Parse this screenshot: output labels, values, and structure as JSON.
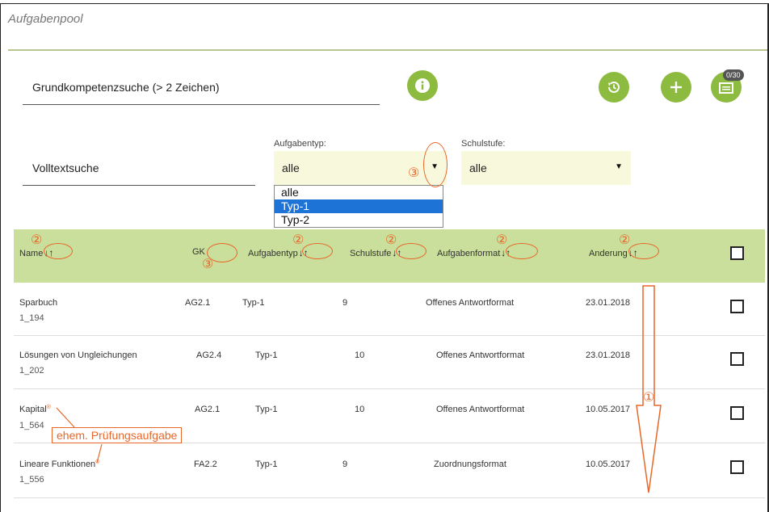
{
  "app": {
    "title": "Aufgabenpool"
  },
  "search": {
    "competence_placeholder": "Grundkompetenzsuche (> 2 Zeichen)",
    "fulltext_placeholder": "Volltextsuche"
  },
  "toolbar": {
    "info_icon": "info-icon",
    "history_icon": "history-icon",
    "add_icon": "plus-icon",
    "collection_icon": "folder-icon",
    "badge": "0/30"
  },
  "filters": {
    "type_label": "Aufgabentyp:",
    "type_value": "alle",
    "type_options": [
      "alle",
      "Typ-1",
      "Typ-2"
    ],
    "type_highlighted": "Typ-1",
    "level_label": "Schulstufe:",
    "level_value": "alle"
  },
  "table": {
    "columns": [
      "Name",
      "GK",
      "Aufgabentyp",
      "Schulstufe",
      "Aufgabenformat",
      "Anderung"
    ],
    "sort_symbol": "↓↑",
    "rows": [
      {
        "name": "Sparbuch",
        "id": "1_194",
        "gk": "AG2.1",
        "typ": "Typ-1",
        "stufe": "9",
        "format": "Offenes Antwortformat",
        "date": "23.01.2018",
        "marked": false
      },
      {
        "name": "Lösungen von Ungleichungen",
        "id": "1_202",
        "gk": "AG2.4",
        "typ": "Typ-1",
        "stufe": "10",
        "format": "Offenes Antwortformat",
        "date": "23.01.2018",
        "marked": false
      },
      {
        "name": "Kapital",
        "id": "1_564",
        "gk": "AG2.1",
        "typ": "Typ-1",
        "stufe": "10",
        "format": "Offenes Antwortformat",
        "date": "10.05.2017",
        "marked": true
      },
      {
        "name": "Lineare Funktionen",
        "id": "1_556",
        "gk": "FA2.2",
        "typ": "Typ-1",
        "stufe": "9",
        "format": "Zuordnungsformat",
        "date": "10.05.2017",
        "marked": true
      }
    ]
  },
  "annotations": {
    "one": "①",
    "two": "②",
    "three": "③",
    "callout": "ehem. Prüfungsaufgabe",
    "color": "#e8672a"
  },
  "colors": {
    "accent": "#8dbb3f",
    "header": "#c9df9b",
    "select_bg": "#f8f8dc",
    "highlight": "#1e73d6"
  }
}
